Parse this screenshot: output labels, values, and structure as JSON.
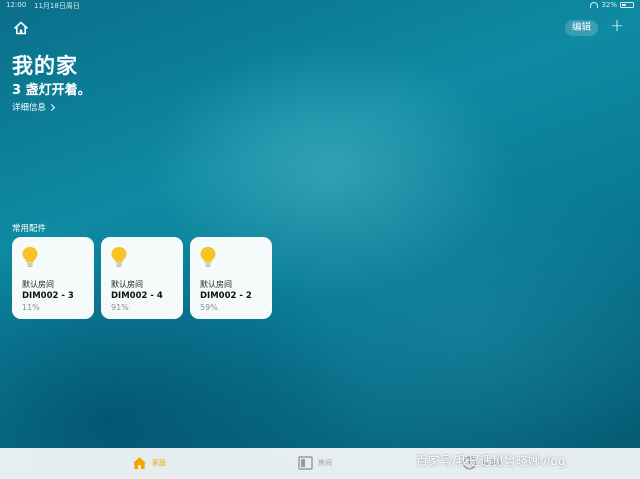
{
  "status_bar": {
    "time": "12:00",
    "date": "11月18日周日",
    "battery": "32%"
  },
  "nav": {
    "edit_label": "编辑",
    "add_label": "+"
  },
  "header": {
    "title": "我的家",
    "summary": "3 盏灯开着。",
    "details_link": "详细信息"
  },
  "favorites": {
    "section_label": "常用配件",
    "accessories": [
      {
        "room": "默认房间",
        "name": "DIM002 - 3",
        "level": "11%",
        "level_value": 11
      },
      {
        "room": "默认房间",
        "name": "DIM002 - 4",
        "level": "91%",
        "level_value": 91
      },
      {
        "room": "默认房间",
        "name": "DIM002 - 2",
        "level": "59%",
        "level_value": 59
      }
    ]
  },
  "tab_bar": {
    "tabs": [
      {
        "label": "家庭",
        "icon": "house-icon",
        "active": true
      },
      {
        "label": "房间",
        "icon": "rooms-icon",
        "active": false
      },
      {
        "label": "自动化",
        "icon": "automation-icon",
        "active": false
      }
    ]
  },
  "watermark": "百家号/我是遇见鲁晓娜vlog",
  "colors": {
    "accent": "#f0a500",
    "bulb": "#f7c325",
    "tile_bg": "#ffffff"
  }
}
